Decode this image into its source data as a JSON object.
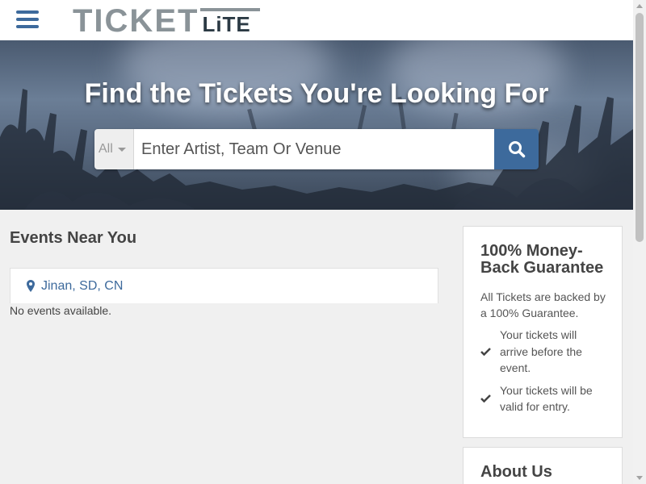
{
  "header": {
    "logo_main": "TICKET",
    "logo_sub": "LiTE",
    "menu_icon": "hamburger-menu-icon"
  },
  "hero": {
    "title": "Find the Tickets You're Looking For",
    "search": {
      "category": "All",
      "placeholder": "Enter Artist, Team Or Venue",
      "value": "",
      "button_icon": "search-icon"
    }
  },
  "main": {
    "heading": "Events Near You",
    "location": "Jinan, SD, CN",
    "location_icon": "map-pin-icon",
    "empty_message": "No events available."
  },
  "sidebar": {
    "guarantee": {
      "title": "100% Money-Back Guarantee",
      "description": "All Tickets are backed by a 100% Guarantee.",
      "items": [
        "Your tickets will arrive before the event.",
        "Your tickets will be valid for entry."
      ],
      "item_icon": "checkmark-icon"
    },
    "about": {
      "title": "About Us"
    }
  },
  "colors": {
    "brand_blue": "#3d6a9c",
    "logo_gray": "#8a9398",
    "logo_dark": "#2b3a44",
    "page_background": "#f0f0f0"
  }
}
